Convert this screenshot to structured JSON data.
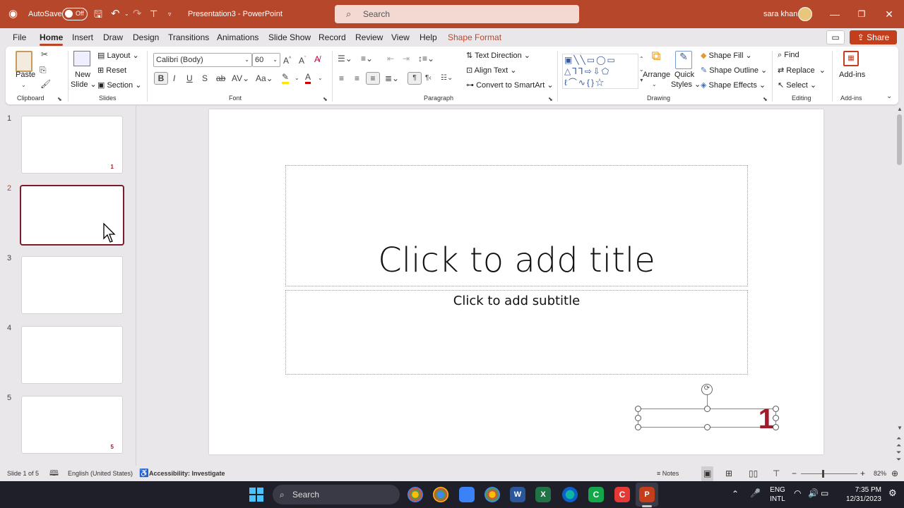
{
  "titlebar": {
    "autosave_label": "AutoSave",
    "autosave_state": "Off",
    "doc_title": "Presentation3  -  PowerPoint",
    "search_placeholder": "Search",
    "user_name": "sara khan"
  },
  "menu": {
    "tabs": [
      "File",
      "Home",
      "Insert",
      "Draw",
      "Design",
      "Transitions",
      "Animations",
      "Slide Show",
      "Record",
      "Review",
      "View",
      "Help",
      "Shape Format"
    ],
    "active_tab": "Home",
    "share_label": "Share"
  },
  "ribbon": {
    "clipboard": {
      "paste": "Paste",
      "group": "Clipboard"
    },
    "slides": {
      "new_slide_1": "New",
      "new_slide_2": "Slide",
      "layout": "Layout",
      "reset": "Reset",
      "section": "Section",
      "group": "Slides"
    },
    "font": {
      "font_name": "Calibri (Body)",
      "font_size": "60",
      "group": "Font"
    },
    "paragraph": {
      "text_direction": "Text Direction",
      "align_text": "Align Text",
      "convert_smartart": "Convert to SmartArt",
      "group": "Paragraph"
    },
    "drawing": {
      "arrange": "Arrange",
      "quick_styles_1": "Quick",
      "quick_styles_2": "Styles",
      "shape_fill": "Shape Fill",
      "shape_outline": "Shape Outline",
      "shape_effects": "Shape Effects",
      "group": "Drawing"
    },
    "editing": {
      "find": "Find",
      "replace": "Replace",
      "select": "Select",
      "group": "Editing"
    },
    "addins": {
      "addins": "Add-ins",
      "group": "Add-ins"
    }
  },
  "thumbnails": [
    {
      "num": "1",
      "label": "1"
    },
    {
      "num": "2",
      "label": ""
    },
    {
      "num": "3",
      "label": ""
    },
    {
      "num": "4",
      "label": ""
    },
    {
      "num": "5",
      "label": "5"
    }
  ],
  "selected_slide": 2,
  "slide": {
    "title_placeholder": "Click to add title",
    "subtitle_placeholder": "Click to add subtitle",
    "slide_number": "1"
  },
  "status": {
    "slide_count": "Slide 1 of 5",
    "language": "English (United States)",
    "accessibility": "Accessibility: Investigate",
    "notes": "Notes",
    "zoom": "82%"
  },
  "taskbar": {
    "search": "Search",
    "lang_1": "ENG",
    "lang_2": "INTL",
    "time": "7:35 PM",
    "date": "12/31/2023"
  },
  "colors": {
    "accent": "#b7472a",
    "selected_border": "#7a1c2c",
    "slide_number": "#a31b2b"
  }
}
